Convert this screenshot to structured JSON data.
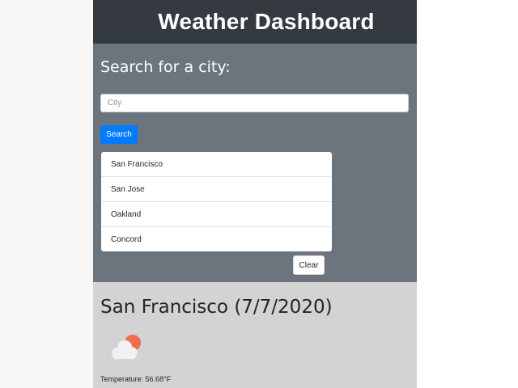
{
  "header": {
    "title": "Weather Dashboard"
  },
  "search": {
    "heading": "Search for a city:",
    "placeholder": "City",
    "value": "",
    "button_label": "Search",
    "clear_label": "Clear",
    "history": [
      "San Francisco",
      "San Jose",
      "Oakland",
      "Concord"
    ]
  },
  "current": {
    "title": "San Francisco (7/7/2020)",
    "icon": "partly-cloudy-icon",
    "temperature": "Temperature: 56.68°F"
  },
  "colors": {
    "header_bg": "#343a40",
    "panel_bg": "#6c757d",
    "content_bg": "#d3d3d3",
    "accent": "#007bff",
    "sun": "#f26a4f"
  }
}
